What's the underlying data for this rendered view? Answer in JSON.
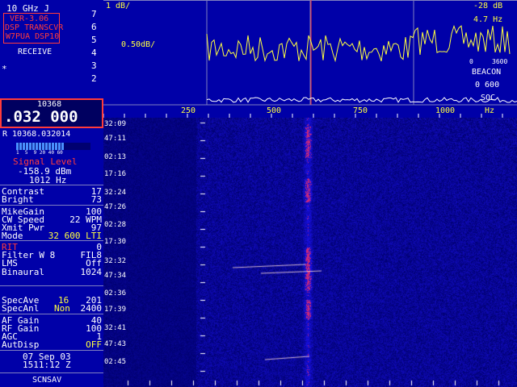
{
  "header": {
    "band": "10 GHz J",
    "version": "VER-3.06",
    "product": "DSP TRANSCVR",
    "station": "W7PUA DSP10",
    "mode_state": "RECEIVE",
    "star": "*"
  },
  "spectrum_scale_digits": [
    "7",
    "6",
    "5",
    "4",
    "3",
    "2"
  ],
  "frequency": {
    "mhz": "10368",
    "khz": ".032 000",
    "readout": "R 10368.032014"
  },
  "signal_meter": {
    "scale": "1  5  9 20 40 60",
    "label": "Signal Level",
    "dbm": "-158.9 dBm",
    "hz": "1012 Hz",
    "level_fraction": 0.65
  },
  "settings": {
    "contrast_label": "Contrast",
    "contrast_value": "17",
    "bright_label": "Bright",
    "bright_value": "73",
    "mikegain_label": "MikeGain",
    "mikegain_value": "100",
    "cwspeed_label": "CW Speed",
    "cwspeed_value": "22 WPM",
    "xmitpwr_label": "Xmit Pwr",
    "xmitpwr_value": "97",
    "mode_label": "Mode",
    "mode_value": "32 600 LTI",
    "rit_label": "RIT",
    "rit_value": "0",
    "filter_label": "Filter W 8",
    "filter_value": "FIL8",
    "lms_label": "LMS",
    "lms_value": "Off",
    "binaural_label": "Binaural",
    "binaural_value": "1024",
    "specave_label": "SpecAve",
    "specave_value1": "16",
    "specave_value2": "201",
    "specanl_label": "SpecAnl",
    "specanl_value1": "Non",
    "specanl_value2": "2400",
    "afgain_label": "AF Gain",
    "afgain_value": "40",
    "rfgain_label": "RF Gain",
    "rfgain_value": "100",
    "agc_label": "AGC",
    "agc_value": "1",
    "autdisp_label": "AutDisp",
    "autdisp_value": "OFF"
  },
  "datetime": {
    "date": "07 Sep 03",
    "time": "1511:12 Z"
  },
  "footer": "SCNSAV",
  "spectrum": {
    "top_left": "1 dB/",
    "top_right": "-28 dB",
    "hz_readout": "4.7 Hz",
    "scale_label": "0.50dB/",
    "range_low": "0",
    "range_high": "3600",
    "beacon_label": "BEACON",
    "beacon_value": "0 600",
    "soc_label": "SOC"
  },
  "freq_axis": {
    "ticks": [
      "250",
      "500",
      "750",
      "1000"
    ],
    "unit": "Hz"
  },
  "waterfall": {
    "times": [
      "32:09",
      "47:11",
      "02:13",
      "17:16",
      "32:24",
      "47:26",
      "02:28",
      "17:30",
      "32:32",
      "47:34",
      "02:36",
      "17:39",
      "32:41",
      "47:43",
      "02:45"
    ]
  }
}
